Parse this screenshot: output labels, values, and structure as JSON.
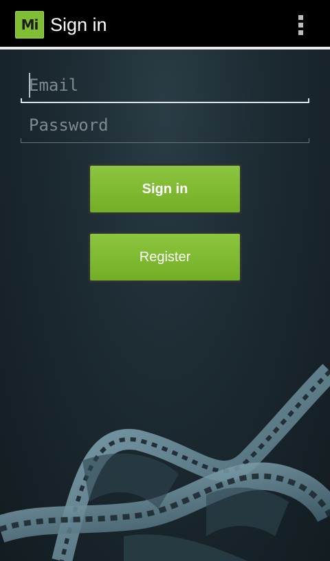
{
  "action_bar": {
    "logo_text": "Mi",
    "title": "Sign in",
    "overflow_icon": "overflow-menu-icon"
  },
  "form": {
    "email": {
      "value": "",
      "placeholder": "Email"
    },
    "password": {
      "value": "",
      "placeholder": "Password"
    }
  },
  "buttons": {
    "sign_in": "Sign in",
    "register": "Register"
  },
  "colors": {
    "accent_green": "#7fbd35",
    "action_bar": "#000000",
    "background": "#1c2a31"
  }
}
